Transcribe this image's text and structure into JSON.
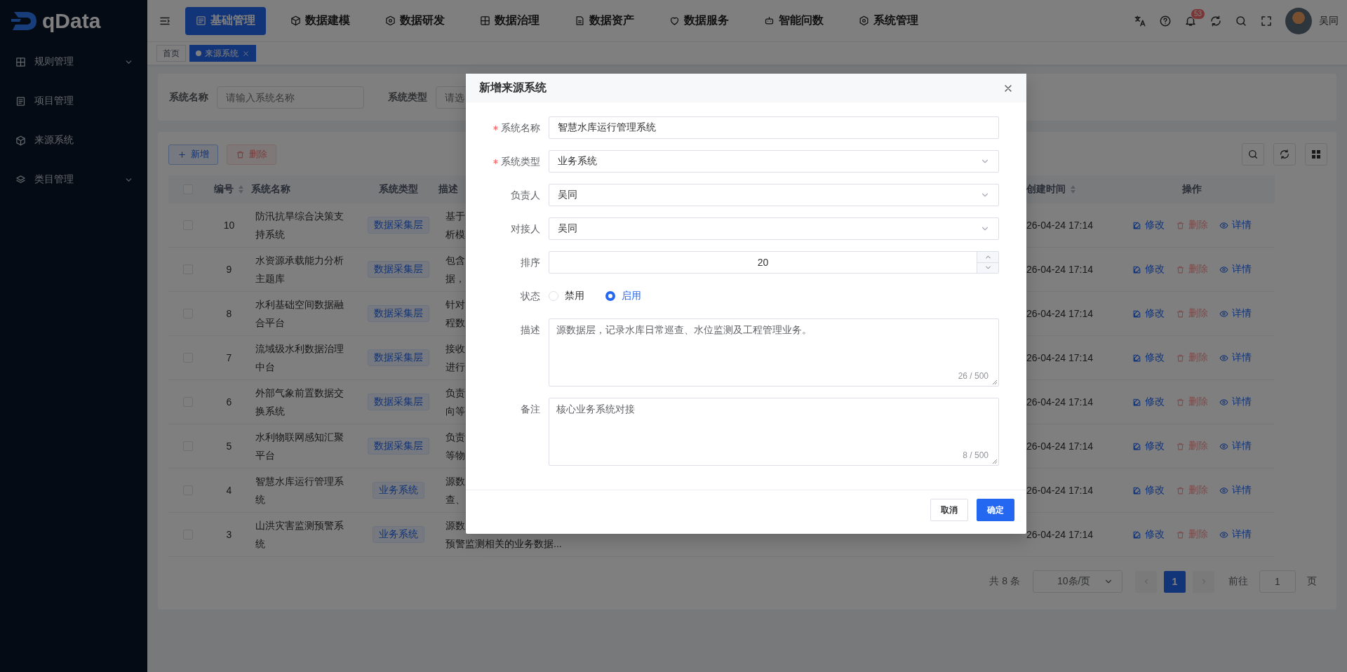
{
  "brand": {
    "name": "qData"
  },
  "top_nav": [
    {
      "label": "基础管理",
      "selected": true
    },
    {
      "label": "数据建模",
      "selected": false
    },
    {
      "label": "数据研发",
      "selected": false
    },
    {
      "label": "数据治理",
      "selected": false
    },
    {
      "label": "数据资产",
      "selected": false
    },
    {
      "label": "数据服务",
      "selected": false
    },
    {
      "label": "智能问数",
      "selected": false
    },
    {
      "label": "系统管理",
      "selected": false
    }
  ],
  "header_user": {
    "name": "吴同",
    "notification_count": "53"
  },
  "sidebar": {
    "items": [
      {
        "label": "规则管理",
        "kind": "group"
      },
      {
        "label": "项目管理",
        "kind": "link"
      },
      {
        "label": "来源系统",
        "kind": "link"
      },
      {
        "label": "类目管理",
        "kind": "group"
      }
    ]
  },
  "tabs": [
    {
      "label": "首页",
      "selected": false
    },
    {
      "label": "来源系统",
      "selected": true
    }
  ],
  "search": {
    "fields": [
      {
        "label": "系统名称",
        "placeholder": "请输入系统名称"
      },
      {
        "label": "系统类型",
        "placeholder": "请选"
      }
    ]
  },
  "toolbar": {
    "buttons": [
      {
        "label": "新增",
        "kind": "add",
        "disabled": false
      },
      {
        "label": "删除",
        "kind": "delete",
        "disabled": true
      }
    ]
  },
  "table": {
    "all_checked": false,
    "columns": [
      {
        "label": "编号",
        "sortable": true
      },
      {
        "label": "系统名称",
        "sortable": false
      },
      {
        "label": "系统类型",
        "sortable": false
      },
      {
        "label": "描述",
        "sortable": false
      },
      {
        "label": "创建时间",
        "sortable": true
      },
      {
        "label": "操作",
        "sortable": false
      }
    ],
    "rows": [
      {
        "id": "10",
        "name": "防汛抗旱综合决策支持系统",
        "type": "数据采集层",
        "description": [
          "基于",
          "析模"
        ],
        "created": "26-04-24 17:14",
        "checked": false,
        "actions": [
          {
            "label": "修改",
            "kind": "edit"
          },
          {
            "label": "删除",
            "kind": "delete"
          },
          {
            "label": "详情",
            "kind": "view"
          }
        ]
      },
      {
        "id": "9",
        "name": "水资源承载能力分析主题库",
        "type": "数据采集层",
        "description": [
          "包含",
          "据，"
        ],
        "created": "26-04-24 17:14",
        "checked": false,
        "actions": [
          {
            "label": "修改",
            "kind": "edit"
          },
          {
            "label": "删除",
            "kind": "delete"
          },
          {
            "label": "详情",
            "kind": "view"
          }
        ]
      },
      {
        "id": "8",
        "name": "水利基础空间数据融合平台",
        "type": "数据采集层",
        "description": [
          "针对",
          "程数"
        ],
        "created": "26-04-24 17:14",
        "checked": false,
        "actions": [
          {
            "label": "修改",
            "kind": "edit"
          },
          {
            "label": "删除",
            "kind": "delete"
          },
          {
            "label": "详情",
            "kind": "view"
          }
        ]
      },
      {
        "id": "7",
        "name": "流域级水利数据治理中台",
        "type": "数据采集层",
        "description": [
          "接收",
          "进行"
        ],
        "created": "26-04-24 17:14",
        "checked": false,
        "actions": [
          {
            "label": "修改",
            "kind": "edit"
          },
          {
            "label": "删除",
            "kind": "delete"
          },
          {
            "label": "详情",
            "kind": "view"
          }
        ]
      },
      {
        "id": "6",
        "name": "外部气象前置数据交换系统",
        "type": "数据采集层",
        "description": [
          "负责",
          "向等"
        ],
        "created": "26-04-24 17:14",
        "checked": false,
        "actions": [
          {
            "label": "修改",
            "kind": "edit"
          },
          {
            "label": "删除",
            "kind": "delete"
          },
          {
            "label": "详情",
            "kind": "view"
          }
        ]
      },
      {
        "id": "5",
        "name": "水利物联网感知汇聚平台",
        "type": "数据采集层",
        "description": [
          "负责",
          "等物"
        ],
        "created": "26-04-24 17:14",
        "checked": false,
        "actions": [
          {
            "label": "修改",
            "kind": "edit"
          },
          {
            "label": "删除",
            "kind": "delete"
          },
          {
            "label": "详情",
            "kind": "view"
          }
        ]
      },
      {
        "id": "4",
        "name": "智慧水库运行管理系统",
        "type": "业务系统",
        "description": [
          "源数",
          "查、"
        ],
        "created": "26-04-24 17:14",
        "checked": false,
        "actions": [
          {
            "label": "修改",
            "kind": "edit"
          },
          {
            "label": "删除",
            "kind": "delete"
          },
          {
            "label": "详情",
            "kind": "view"
          }
        ]
      },
      {
        "id": "3",
        "name": "山洪灾害监测预警系统",
        "type": "业务系统",
        "description": [
          "源数",
          "预警监测相关的业务数据..."
        ],
        "created": "26-04-24 17:14",
        "checked": false,
        "actions": [
          {
            "label": "修改",
            "kind": "edit"
          },
          {
            "label": "删除",
            "kind": "delete"
          },
          {
            "label": "详情",
            "kind": "view"
          }
        ]
      }
    ]
  },
  "pagination": {
    "total": "共 8 条",
    "page_size": "10条/页",
    "pages": [
      {
        "label": "1",
        "selected": true
      }
    ],
    "goto_label": "前往",
    "goto_value": "1",
    "page_suffix": "页"
  },
  "dialog": {
    "title": "新增来源系统",
    "fields": [
      {
        "label": "系统名称",
        "required": true,
        "kind": "text",
        "value": "智慧水库运行管理系统"
      },
      {
        "label": "系统类型",
        "required": true,
        "kind": "select",
        "value": "业务系统"
      },
      {
        "label": "负责人",
        "required": false,
        "kind": "select",
        "value": "吴同"
      },
      {
        "label": "对接人",
        "required": false,
        "kind": "select",
        "value": "吴同"
      },
      {
        "label": "排序",
        "required": false,
        "kind": "number",
        "value": "20"
      },
      {
        "label": "状态",
        "required": false,
        "kind": "radio",
        "options": [
          {
            "label": "禁用",
            "selected": false
          },
          {
            "label": "启用",
            "selected": true
          }
        ]
      },
      {
        "label": "描述",
        "required": false,
        "kind": "textarea",
        "value": "源数据层，记录水库日常巡查、水位监测及工程管理业务。",
        "count": "26 / 500"
      },
      {
        "label": "备注",
        "required": false,
        "kind": "textarea",
        "value": "核心业务系统对接",
        "count": "8 / 500"
      }
    ],
    "buttons": [
      {
        "label": "取消",
        "kind": "default"
      },
      {
        "label": "确定",
        "kind": "primary"
      }
    ]
  }
}
